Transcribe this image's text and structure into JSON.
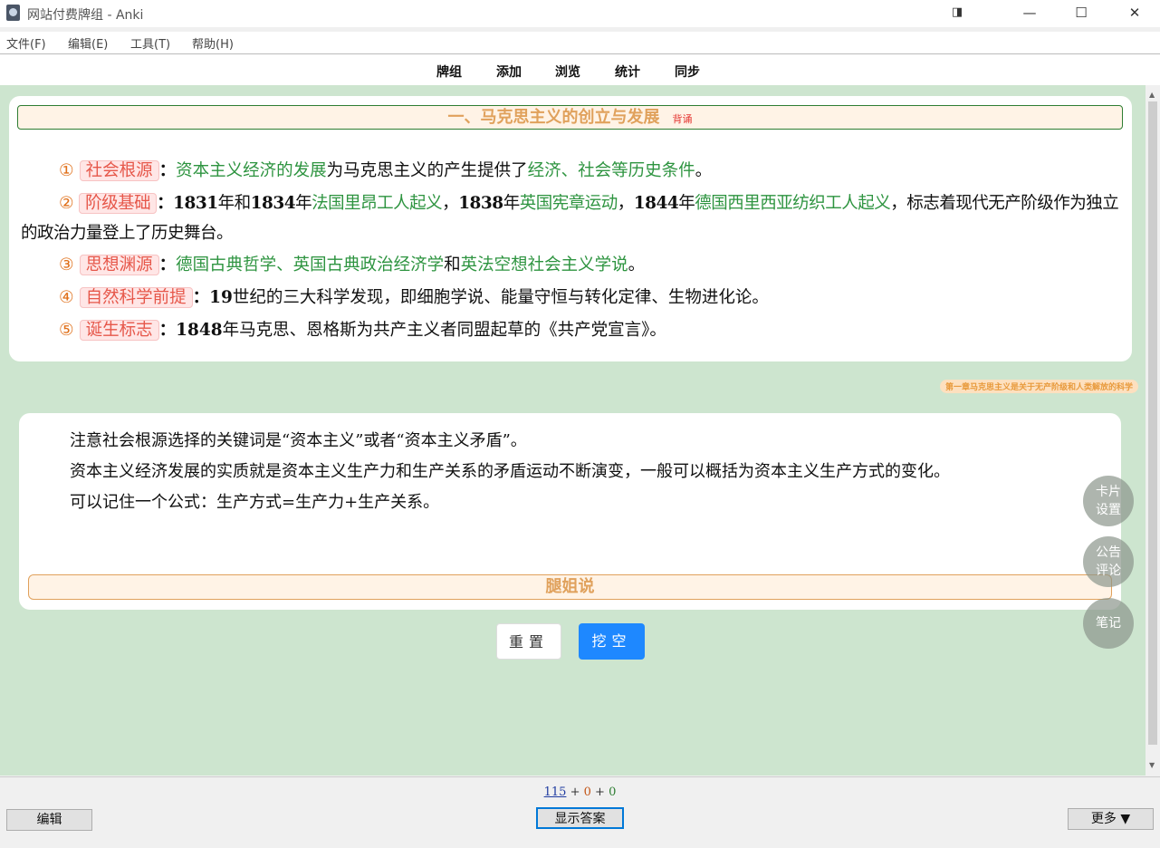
{
  "window": {
    "title": "网站付费牌组 - Anki",
    "controls": {
      "restore": "◨",
      "minimize": "—",
      "maximize": "☐",
      "close": "✕"
    }
  },
  "menu": [
    "文件(F)",
    "编辑(E)",
    "工具(T)",
    "帮助(H)"
  ],
  "toolbar": [
    "牌组",
    "添加",
    "浏览",
    "统计",
    "同步"
  ],
  "front": {
    "section_title": "一、马克思主义的创立与发展",
    "section_tag": "背诵",
    "points": [
      {
        "num": "①",
        "tag": "社会根源",
        "sep": "：",
        "parts": [
          {
            "t": "资本主义经济的发展",
            "c": "g"
          },
          {
            "t": "为马克思主义的产生提供了"
          },
          {
            "t": "经济、社会等历史条件",
            "c": "g"
          },
          {
            "t": "。"
          }
        ]
      },
      {
        "num": "②",
        "tag": "阶级基础",
        "sep": "：",
        "parts": [
          {
            "t": "1831",
            "c": "b"
          },
          {
            "t": "年和"
          },
          {
            "t": "1834",
            "c": "b"
          },
          {
            "t": "年"
          },
          {
            "t": "法国里昂工人起义",
            "c": "g"
          },
          {
            "t": "，"
          },
          {
            "t": "1838",
            "c": "b"
          },
          {
            "t": "年"
          },
          {
            "t": "英国宪章运动",
            "c": "g"
          },
          {
            "t": "，"
          },
          {
            "t": "1844",
            "c": "b"
          },
          {
            "t": "年"
          },
          {
            "t": "德国西里西亚纺织工人起义",
            "c": "g"
          },
          {
            "t": "，标志着现代无产阶级作为独立的政治力量登上了历史舞台。"
          }
        ]
      },
      {
        "num": "③",
        "tag": "思想渊源",
        "sep": "：",
        "parts": [
          {
            "t": "德国古典哲学、英国古典政治经济学",
            "c": "g"
          },
          {
            "t": "和"
          },
          {
            "t": "英法空想社会主义学说",
            "c": "g"
          },
          {
            "t": "。"
          }
        ]
      },
      {
        "num": "④",
        "tag": "自然科学前提",
        "sep": "：",
        "parts": [
          {
            "t": "19",
            "c": "b"
          },
          {
            "t": "世纪的三大科学发现，即细胞学说、能量守恒与转化定律、生物进化论。"
          }
        ]
      },
      {
        "num": "⑤",
        "tag": "诞生标志",
        "sep": "：",
        "parts": [
          {
            "t": "1848",
            "c": "b"
          },
          {
            "t": "年马克思、恩格斯为共产主义者同盟起草的《共产党宣言》。"
          }
        ]
      }
    ]
  },
  "chapter_badge": "第一章马克思主义是关于无产阶级和人类解放的科学",
  "back": {
    "paragraphs": [
      "注意社会根源选择的关键词是“资本主义”或者“资本主义矛盾”。",
      "资本主义经济发展的实质就是资本主义生产力和生产关系的矛盾运动不断演变，一般可以概括为资本主义生产方式的变化。",
      "可以记住一个公式：生产方式=生产力+生产关系。"
    ],
    "header": "腿姐说"
  },
  "card_buttons": {
    "reset": "重置",
    "dig": "挖空"
  },
  "fabs": [
    {
      "line1": "卡片",
      "line2": "设置"
    },
    {
      "line1": "公告",
      "line2": "评论"
    },
    {
      "line1": "笔记",
      "line2": ""
    }
  ],
  "bottom": {
    "counts": {
      "new": "115",
      "learn": "0",
      "review": "0",
      "sep": "+"
    },
    "edit": "编辑",
    "show_answer": "显示答案",
    "more": "更多 ▼"
  },
  "colors": {
    "reviewer_bg": "#cde5cf",
    "accent_green": "#2e9440",
    "tag_red": "#e6574a",
    "primary_blue": "#1e88ff"
  }
}
